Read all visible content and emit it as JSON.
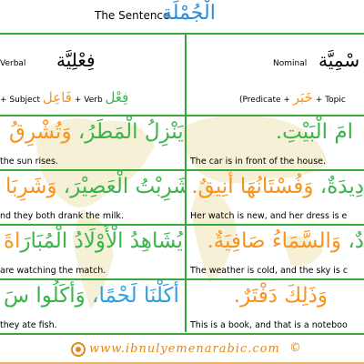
{
  "header": {
    "title_en": "The Sentence",
    "title_ar": "الْجُمْلَة"
  },
  "left": {
    "type_ar": "فِعْلِيَّة",
    "type_en": "Verbal",
    "structure": {
      "prefix": "+ Subject",
      "subject_ar": "فَاعِل",
      "mid": "+ Verb",
      "verb_ar": "فِعْل"
    },
    "rows": [
      {
        "parts": [
          {
            "text": "يَنْزِلُ الْمَطَرُ، ",
            "color": "green"
          },
          {
            "text": "وَتُشْرِقُ",
            "color": "orange"
          }
        ],
        "translation": "the sun rises."
      },
      {
        "parts": [
          {
            "text": "شَرِبْتُ الْعَصِيْرَ، ",
            "color": "green"
          },
          {
            "text": "وَشَرِبَا",
            "color": "orange"
          }
        ],
        "translation": "nd they both drank the milk."
      },
      {
        "parts": [
          {
            "text": "يُشَاهِدُ الْأَوْلَادُ الْمُبَارَ",
            "color": "green"
          },
          {
            "text": "اةَ",
            "color": "orange"
          }
        ],
        "translation": "are watching the match."
      },
      {
        "parts": [
          {
            "text": "أَكَلْنَا لَحْمًا، ",
            "color": "blue"
          },
          {
            "text": "وَأَكَلُوا سَ",
            "color": "green"
          }
        ],
        "translation": "they ate fish."
      }
    ]
  },
  "right": {
    "type_ar": "سْمِيَّة",
    "type_en": "Nominal",
    "structure": {
      "open": "(Predicate +",
      "predicate_ar": "خَبَر",
      "close": "+ Topic"
    },
    "rows": [
      {
        "parts": [
          {
            "text": "امَ الْبَيْتِ.",
            "color": "green"
          }
        ],
        "translation": "The car is in front of the house."
      },
      {
        "parts": [
          {
            "text": "دِيدَةٌ، ",
            "color": "green"
          },
          {
            "text": "وَفُسْتَانُهَا أَنِيقٌ.",
            "color": "orange"
          }
        ],
        "translation": "Her watch is new, and her dress is e"
      },
      {
        "parts": [
          {
            "text": "دٌ، ",
            "color": "green"
          },
          {
            "text": "وَالسَّمَاءُ صَافِيَةٌ.",
            "color": "orange"
          }
        ],
        "translation": "The weather is cold, and the sky is c"
      },
      {
        "parts": [
          {
            "text": "وَذَلِكَ دَفْتَرٌ.",
            "color": "orange"
          }
        ],
        "translation": "This is a book, and that is a noteboo"
      }
    ]
  },
  "footer": {
    "url": "www.ibnulyemenarabic.com",
    "copyright": "©"
  },
  "colors": {
    "green": "#39b54a",
    "orange": "#f7941d",
    "blue": "#2e9fe0",
    "grid": "#38a838",
    "title_ar": "#2a8cd8",
    "footer": "#e0891a"
  }
}
